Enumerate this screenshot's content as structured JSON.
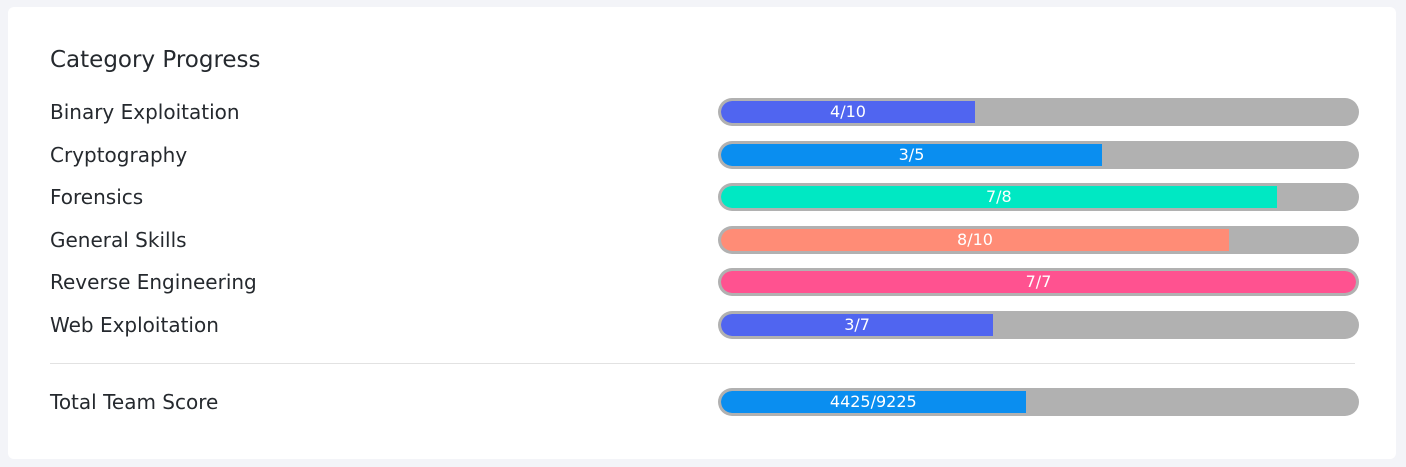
{
  "title": "Category Progress",
  "categories": [
    {
      "label": "Binary Exploitation",
      "text": "4/10",
      "progress": 0.4,
      "color": "#5065f0"
    },
    {
      "label": "Cryptography",
      "text": "3/5",
      "progress": 0.6,
      "color": "#0a8ef0"
    },
    {
      "label": "Forensics",
      "text": "7/8",
      "progress": 0.875,
      "color": "#00e8c3"
    },
    {
      "label": "General Skills",
      "text": "8/10",
      "progress": 0.8,
      "color": "#ff8c76"
    },
    {
      "label": "Reverse Engineering",
      "text": "7/7",
      "progress": 1.0,
      "color": "#ff5290"
    },
    {
      "label": "Web Exploitation",
      "text": "3/7",
      "progress": 0.4286,
      "color": "#5065f0"
    }
  ],
  "total": {
    "label": "Total Team Score",
    "text": "4425/9225",
    "progress": 0.4797,
    "color": "#0a8ef0"
  }
}
